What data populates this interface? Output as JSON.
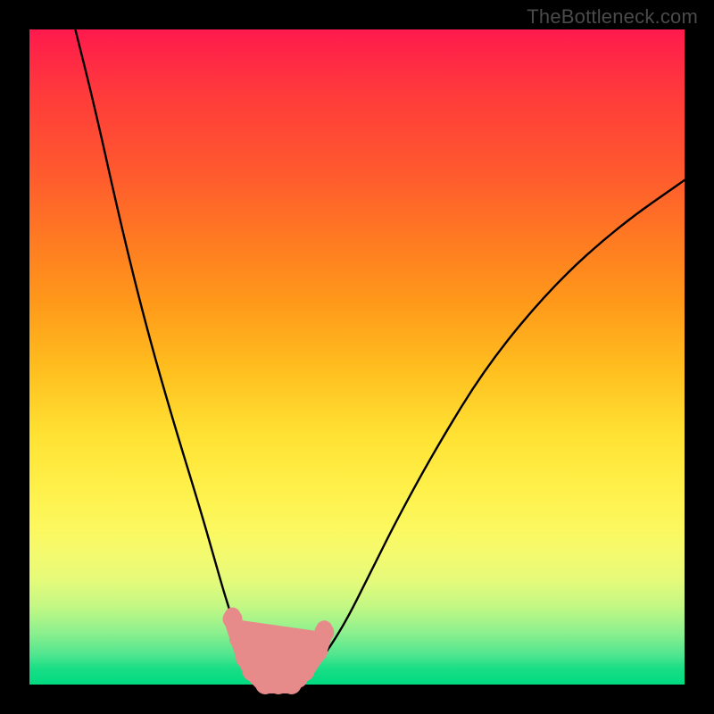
{
  "watermark": "TheBottleneck.com",
  "chart_data": {
    "type": "line",
    "title": "",
    "xlabel": "",
    "ylabel": "",
    "xlim": [
      0,
      100
    ],
    "ylim": [
      0,
      100
    ],
    "background": "rainbow-gradient (red top → green bottom)",
    "curve": {
      "description": "V-shaped bottleneck curve; minimum (0%) near x≈35–40, rising steeply on both sides",
      "x": [
        7,
        10,
        14,
        18,
        22,
        26,
        28,
        30,
        32,
        34,
        36,
        38,
        40,
        42,
        44,
        48,
        52,
        56,
        62,
        70,
        80,
        90,
        100
      ],
      "y": [
        100,
        88,
        70,
        54,
        40,
        27,
        20,
        13,
        7,
        3,
        1,
        0,
        0,
        1,
        3,
        9,
        17,
        25,
        36,
        49,
        61,
        70,
        77
      ]
    },
    "markers": {
      "description": "salmon-pink dots and connector clustered around the trough",
      "points": [
        {
          "x": 31,
          "y": 10
        },
        {
          "x": 32,
          "y": 7
        },
        {
          "x": 33,
          "y": 4
        },
        {
          "x": 34,
          "y": 2
        },
        {
          "x": 36,
          "y": 0
        },
        {
          "x": 38,
          "y": 0
        },
        {
          "x": 40,
          "y": 0
        },
        {
          "x": 41,
          "y": 1
        },
        {
          "x": 42,
          "y": 2
        },
        {
          "x": 44,
          "y": 5
        },
        {
          "x": 45,
          "y": 8
        }
      ]
    }
  }
}
